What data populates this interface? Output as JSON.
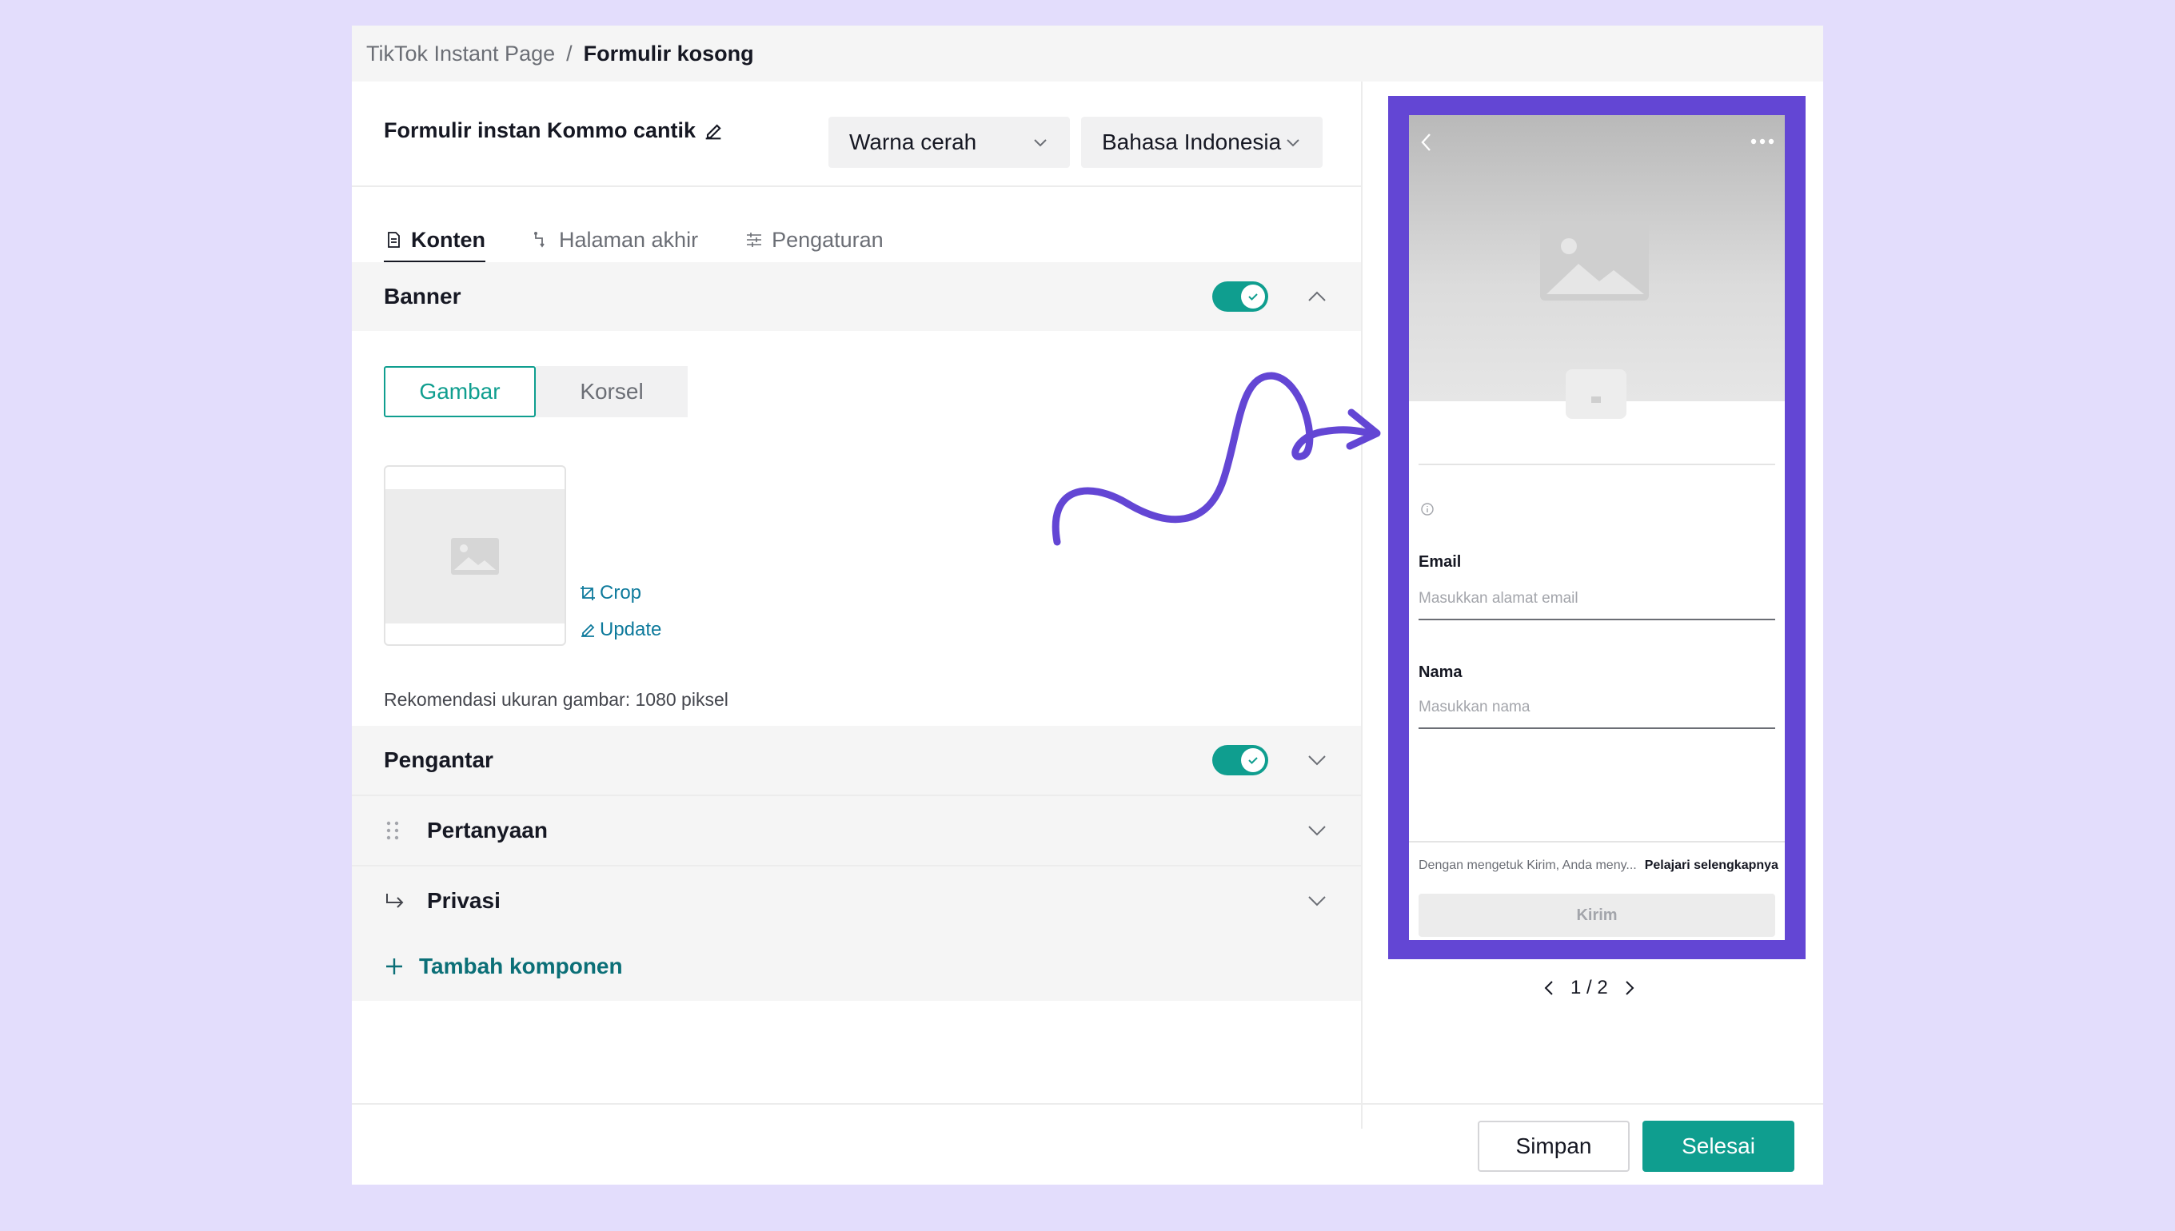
{
  "breadcrumb": {
    "parent": "TikTok Instant Page",
    "separator": "/",
    "current": "Formulir kosong"
  },
  "form": {
    "title": "Formulir instan Kommo cantik"
  },
  "selects": {
    "theme": "Warna cerah",
    "language": "Bahasa Indonesia"
  },
  "tabs": [
    {
      "label": "Konten",
      "active": true
    },
    {
      "label": "Halaman akhir",
      "active": false
    },
    {
      "label": "Pengaturan",
      "active": false
    }
  ],
  "banner": {
    "title": "Banner",
    "enabled": true,
    "segment": {
      "image": "Gambar",
      "carousel": "Korsel"
    },
    "crop": "Crop",
    "update": "Update",
    "hint": "Rekomendasi ukuran gambar: 1080 piksel"
  },
  "sections": {
    "intro": {
      "title": "Pengantar",
      "enabled": true
    },
    "questions": {
      "title": "Pertanyaan"
    },
    "privacy": {
      "title": "Privasi"
    }
  },
  "add_component": "Tambah komponen",
  "buttons": {
    "save": "Simpan",
    "done": "Selesai"
  },
  "preview": {
    "email_label": "Email",
    "email_placeholder": "Masukkan alamat email",
    "name_label": "Nama",
    "name_placeholder": "Masukkan nama",
    "terms": "Dengan mengetuk Kirim, Anda meny...",
    "learn_more": "Pelajari selengkapnya",
    "submit": "Kirim",
    "page": "1 / 2"
  },
  "colors": {
    "accent": "#0f9e8f",
    "frame": "#6346d4",
    "background": "#e3ddfc"
  }
}
